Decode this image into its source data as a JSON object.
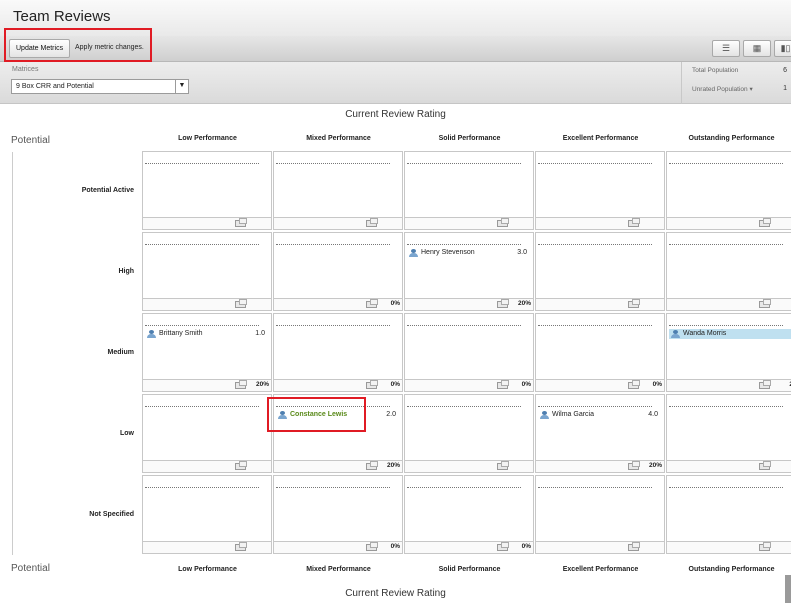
{
  "window": {
    "title": "Team Reviews"
  },
  "toolbar": {
    "update_label": "Update Metrics",
    "hint": "Apply metric changes.",
    "view_icons": [
      "list-view-icon",
      "grid-view-icon",
      "chart-view-icon"
    ]
  },
  "filters": {
    "metrics_label": "Matrices",
    "metrics_value": "9 Box CRR and Potential"
  },
  "stats": {
    "total_label": "Total Population",
    "total_value": "6",
    "unrated_label": "Unrated Population",
    "unrated_value": "1"
  },
  "axes": {
    "x_title": "Current Review Rating",
    "y_title": "Potential"
  },
  "columns": [
    "Low Performance",
    "Mixed Performance",
    "Solid Performance",
    "Excellent Performance",
    "Outstanding Performance"
  ],
  "rows": [
    {
      "label": "Potential Active",
      "cells": [
        {
          "pct": "",
          "employees": []
        },
        {
          "pct": "",
          "employees": []
        },
        {
          "pct": "",
          "employees": []
        },
        {
          "pct": "",
          "employees": []
        },
        {
          "pct": "",
          "employees": []
        }
      ]
    },
    {
      "label": "High",
      "cells": [
        {
          "pct": "",
          "employees": []
        },
        {
          "pct": "0%",
          "employees": []
        },
        {
          "pct": "20%",
          "employees": [
            {
              "name": "Henry Stevenson",
              "score": "3.0"
            }
          ]
        },
        {
          "pct": "",
          "employees": []
        },
        {
          "pct": "",
          "employees": []
        }
      ]
    },
    {
      "label": "Medium",
      "cells": [
        {
          "pct": "20%",
          "employees": [
            {
              "name": "Brittany Smith",
              "score": "1.0"
            }
          ]
        },
        {
          "pct": "0%",
          "employees": []
        },
        {
          "pct": "0%",
          "employees": []
        },
        {
          "pct": "0%",
          "employees": []
        },
        {
          "pct": "2",
          "employees": [
            {
              "name": "Wanda Morris",
              "score": "",
              "selected": true
            }
          ]
        }
      ]
    },
    {
      "label": "Low",
      "cells": [
        {
          "pct": "",
          "employees": []
        },
        {
          "pct": "20%",
          "employees": [
            {
              "name": "Constance Lewis",
              "score": "2.0",
              "highlight": true
            }
          ]
        },
        {
          "pct": "",
          "employees": []
        },
        {
          "pct": "20%",
          "employees": [
            {
              "name": "Wilma Garcia",
              "score": "4.0"
            }
          ]
        },
        {
          "pct": "",
          "employees": []
        }
      ]
    },
    {
      "label": "Not Specified",
      "cells": [
        {
          "pct": "",
          "employees": []
        },
        {
          "pct": "0%",
          "employees": []
        },
        {
          "pct": "0%",
          "employees": []
        },
        {
          "pct": "",
          "employees": []
        },
        {
          "pct": "",
          "employees": []
        }
      ]
    }
  ]
}
